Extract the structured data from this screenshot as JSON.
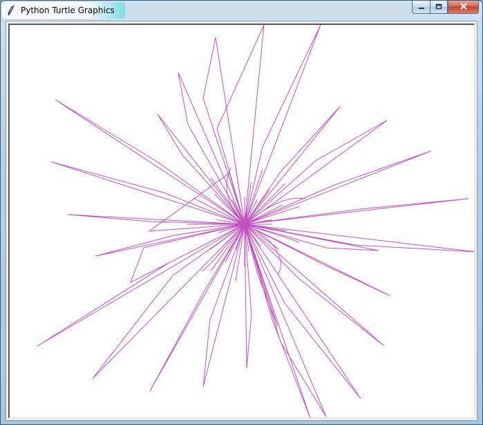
{
  "window": {
    "title": "Python Turtle Graphics",
    "controls": [
      "minimize-icon",
      "maximize-icon",
      "close-icon"
    ]
  },
  "turtle": {
    "pen_color": "#c050c0",
    "background": "#ffffff"
  }
}
